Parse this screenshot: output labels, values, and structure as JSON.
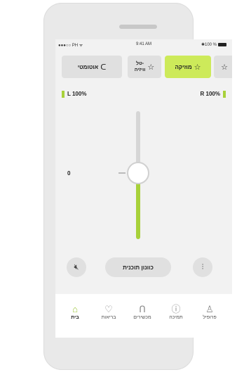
{
  "status_bar": {
    "left": "●●●○○ PH ᯤ",
    "time": "9:41 AM",
    "right": "✱100 %"
  },
  "programs": {
    "auto_label": "אוטומטי",
    "tv_label": "טל-\nוויזיה",
    "music_label": "מוזיקה",
    "active": "music"
  },
  "volume": {
    "left_label": "L 100%",
    "right_label": "R 100%",
    "level_value": "0"
  },
  "controls": {
    "customize_label": "כוונון תוכנית"
  },
  "tabs": [
    {
      "label": "בית",
      "icon": "home-icon",
      "active": true
    },
    {
      "label": "בריאות",
      "icon": "heart-icon",
      "active": false
    },
    {
      "label": "מכשירים",
      "icon": "hearing-aid-icon",
      "active": false
    },
    {
      "label": "תמיכה",
      "icon": "help-icon",
      "active": false
    },
    {
      "label": "פרופיל",
      "icon": "profile-icon",
      "active": false
    }
  ],
  "colors": {
    "accent": "#a8d13a",
    "chip_active": "#cdea5a",
    "chip_inactive": "#e0e0e0"
  }
}
